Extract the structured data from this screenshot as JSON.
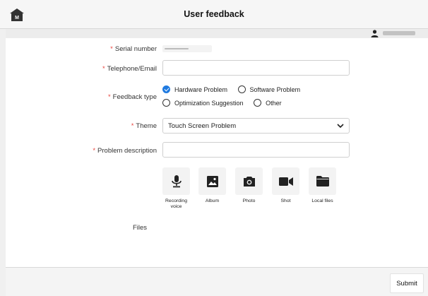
{
  "header": {
    "title": "User feedback",
    "home_icon": "home-icon",
    "home_badge": "M"
  },
  "user": {
    "icon": "user-icon"
  },
  "form": {
    "serial_number": {
      "label": "Serial number",
      "required_mark": "*"
    },
    "contact": {
      "label": "Telephone/Email",
      "required_mark": "*",
      "value": "",
      "placeholder": ""
    },
    "feedback_type": {
      "label": "Feedback type",
      "required_mark": "*",
      "options": [
        {
          "label": "Hardware Problem",
          "selected": true
        },
        {
          "label": "Software Problem",
          "selected": false
        },
        {
          "label": "Optimization Suggestion",
          "selected": false
        },
        {
          "label": "Other",
          "selected": false
        }
      ]
    },
    "theme": {
      "label": "Theme",
      "required_mark": "*",
      "value": "Touch Screen Problem"
    },
    "problem_description": {
      "label": "Problem description",
      "required_mark": "*",
      "value": ""
    },
    "attachments": [
      {
        "label": "Recording voice",
        "icon": "microphone-icon"
      },
      {
        "label": "Album",
        "icon": "image-icon"
      },
      {
        "label": "Photo",
        "icon": "camera-icon"
      },
      {
        "label": "Shot",
        "icon": "video-camera-icon"
      },
      {
        "label": "Local files",
        "icon": "folder-icon"
      }
    ],
    "files_label": "Files"
  },
  "footer": {
    "submit_label": "Submit"
  },
  "colors": {
    "accent": "#1f7ae0",
    "required": "#e8463f"
  }
}
